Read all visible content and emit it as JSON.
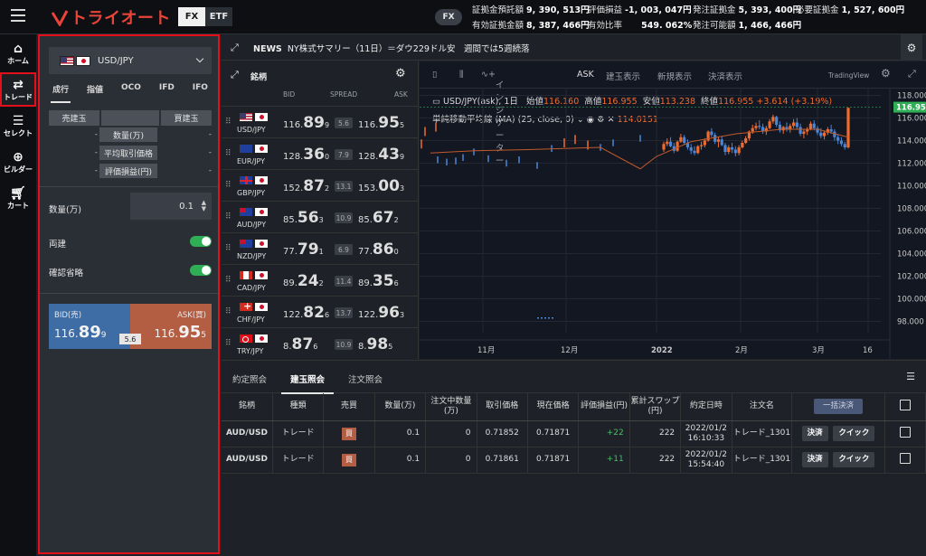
{
  "header": {
    "logo_text": "トライオート",
    "tabs": [
      "FX",
      "ETF"
    ],
    "active_tab": "FX",
    "account_pill": "FX",
    "stats": [
      {
        "label": "証拠金預託額",
        "value": "9, 390, 513円"
      },
      {
        "label": "評価損益",
        "value": "-1, 003, 047円"
      },
      {
        "label": "発注証拠金",
        "value": "5, 393, 400円"
      },
      {
        "label": "必要証拠金",
        "value": "1, 527, 600円"
      },
      {
        "label": "有効証拠金額",
        "value": "8, 387, 466円"
      },
      {
        "label": "有効比率",
        "value": "549. 062%"
      },
      {
        "label": "発注可能額",
        "value": "1, 466, 466円"
      }
    ]
  },
  "nav": [
    {
      "label": "ホーム",
      "icon": "home-icon"
    },
    {
      "label": "トレード",
      "icon": "trade-icon"
    },
    {
      "label": "セレクト",
      "icon": "select-icon"
    },
    {
      "label": "ビルダー",
      "icon": "builder-icon"
    },
    {
      "label": "カート",
      "icon": "cart-icon"
    }
  ],
  "order": {
    "pair": "USD/JPY",
    "tabs": [
      "成行",
      "指値",
      "OCO",
      "IFD",
      "IFO"
    ],
    "active_tab": "成行",
    "pos_headers": {
      "sell": "売建玉",
      "buy": "買建玉"
    },
    "pos_rows": [
      {
        "label": "数量(万)",
        "left": "-",
        "right": "-"
      },
      {
        "label": "平均取引価格",
        "left": "-",
        "right": "-"
      },
      {
        "label": "評価損益(円)",
        "left": "-",
        "right": "-"
      }
    ],
    "qty_label": "数量(万)",
    "qty_value": "0.1",
    "hedge_label": "両建",
    "confirm_label": "確認省略",
    "bid_label": "BID(売)",
    "ask_label": "ASK(買)",
    "bid_price": {
      "pre": "116.",
      "big": "89",
      "small": "9"
    },
    "ask_price": {
      "pre": "116.",
      "big": "95",
      "small": "5"
    },
    "spread": "5.6"
  },
  "news": {
    "label": "NEWS",
    "headline": "NY株式サマリー（11日）＝ダウ229ドル安　週間では5週続落"
  },
  "rates": {
    "title": "銘柄",
    "col_bid": "BID",
    "col_spread": "SPREAD",
    "col_ask": "ASK",
    "rows": [
      {
        "sym": "USD/JPY",
        "f": "us",
        "bid_pre": "116.",
        "bid_big": "89",
        "bid_small": "9",
        "spread": "5.6",
        "ask_pre": "116.",
        "ask_big": "95",
        "ask_small": "5"
      },
      {
        "sym": "EUR/JPY",
        "f": "eu",
        "bid_pre": "128.",
        "bid_big": "36",
        "bid_small": "0",
        "spread": "7.9",
        "ask_pre": "128.",
        "ask_big": "43",
        "ask_small": "9"
      },
      {
        "sym": "GBP/JPY",
        "f": "gb",
        "bid_pre": "152.",
        "bid_big": "87",
        "bid_small": "2",
        "spread": "13.1",
        "ask_pre": "153.",
        "ask_big": "00",
        "ask_small": "3"
      },
      {
        "sym": "AUD/JPY",
        "f": "au",
        "bid_pre": "85.",
        "bid_big": "56",
        "bid_small": "3",
        "spread": "10.9",
        "ask_pre": "85.",
        "ask_big": "67",
        "ask_small": "2"
      },
      {
        "sym": "NZD/JPY",
        "f": "nz",
        "bid_pre": "77.",
        "bid_big": "79",
        "bid_small": "1",
        "spread": "6.9",
        "ask_pre": "77.",
        "ask_big": "86",
        "ask_small": "0"
      },
      {
        "sym": "CAD/JPY",
        "f": "ca",
        "bid_pre": "89.",
        "bid_big": "24",
        "bid_small": "2",
        "spread": "11.4",
        "ask_pre": "89.",
        "ask_big": "35",
        "ask_small": "6"
      },
      {
        "sym": "CHF/JPY",
        "f": "ch",
        "bid_pre": "122.",
        "bid_big": "82",
        "bid_small": "6",
        "spread": "13.7",
        "ask_pre": "122.",
        "ask_big": "96",
        "ask_small": "3"
      },
      {
        "sym": "TRY/JPY",
        "f": "tr",
        "bid_pre": "8.",
        "bid_big": "87",
        "bid_small": "6",
        "spread": "10.9",
        "ask_pre": "8.",
        "ask_big": "98",
        "ask_small": "5"
      }
    ]
  },
  "chart_toolbar": {
    "indicator": "インジケーター",
    "ask": "ASK",
    "b1": "建玉表示",
    "b2": "新規表示",
    "b3": "決済表示",
    "brand": "TradingView"
  },
  "chart_info": {
    "symbol": "USD/JPY(ask), 1日",
    "open_label": "始値",
    "open": "116.160",
    "high_label": "高値",
    "high": "116.955",
    "low_label": "安値",
    "low": "113.238",
    "close_label": "終値",
    "close": "116.955",
    "change": "+3.614 (+3.19%)",
    "ma_label": "単純移動平均線 (MA) (25, close, 0)",
    "ma_value": "114.0151"
  },
  "chart_data": {
    "type": "candlestick",
    "x_ticks": [
      "11月",
      "12月",
      "2022",
      "2月",
      "3月",
      "16"
    ],
    "y_ticks": [
      98.0,
      100.0,
      102.0,
      104.0,
      106.0,
      108.0,
      110.0,
      112.0,
      114.0,
      116.0,
      118.0
    ],
    "ylim": [
      97.0,
      118.6
    ],
    "last_price": "116.955",
    "candles": [
      [
        113.2,
        113.9,
        113.0,
        113.7
      ],
      [
        113.7,
        114.2,
        113.5,
        113.9
      ],
      [
        113.9,
        114.3,
        113.4,
        113.5
      ],
      [
        113.5,
        113.8,
        112.9,
        113.1
      ],
      [
        113.1,
        114.0,
        113.0,
        113.9
      ],
      [
        113.9,
        114.6,
        113.8,
        114.3
      ],
      [
        114.3,
        114.5,
        113.6,
        113.8
      ],
      [
        113.8,
        114.1,
        113.2,
        113.4
      ],
      [
        113.4,
        113.7,
        112.8,
        113.1
      ],
      [
        113.1,
        113.5,
        112.7,
        112.9
      ],
      [
        112.9,
        113.6,
        112.8,
        113.5
      ],
      [
        113.5,
        113.9,
        113.2,
        113.6
      ],
      [
        113.6,
        114.2,
        113.4,
        114.0
      ],
      [
        114.0,
        114.9,
        113.9,
        114.8
      ],
      [
        114.8,
        115.1,
        114.3,
        114.5
      ],
      [
        114.5,
        114.7,
        113.7,
        113.9
      ],
      [
        113.9,
        114.3,
        113.4,
        114.1
      ],
      [
        114.1,
        114.4,
        113.5,
        113.6
      ],
      [
        113.6,
        113.8,
        112.7,
        113.0
      ],
      [
        113.0,
        113.6,
        112.8,
        113.4
      ],
      [
        113.4,
        113.8,
        112.9,
        113.2
      ],
      [
        113.2,
        113.5,
        112.6,
        112.9
      ],
      [
        112.9,
        113.6,
        112.7,
        113.4
      ],
      [
        113.4,
        114.0,
        113.3,
        113.8
      ],
      [
        113.8,
        114.4,
        113.7,
        114.2
      ],
      [
        114.2,
        114.9,
        114.0,
        114.8
      ],
      [
        114.8,
        115.4,
        114.6,
        115.1
      ],
      [
        115.1,
        115.6,
        114.9,
        115.3
      ],
      [
        115.3,
        115.8,
        115.0,
        115.2
      ],
      [
        115.2,
        115.5,
        114.6,
        114.8
      ],
      [
        114.8,
        115.3,
        114.5,
        115.1
      ],
      [
        115.1,
        115.9,
        115.0,
        115.7
      ],
      [
        115.7,
        116.3,
        115.5,
        116.1
      ],
      [
        116.1,
        116.2,
        115.2,
        115.4
      ],
      [
        115.4,
        115.7,
        114.7,
        114.9
      ],
      [
        114.9,
        115.3,
        114.6,
        115.2
      ],
      [
        115.2,
        115.6,
        114.8,
        115.0
      ],
      [
        115.0,
        115.5,
        114.7,
        115.3
      ],
      [
        115.3,
        115.9,
        115.1,
        115.6
      ],
      [
        115.6,
        116.0,
        115.0,
        115.2
      ],
      [
        115.2,
        115.5,
        114.4,
        114.6
      ],
      [
        114.6,
        115.0,
        114.2,
        114.8
      ],
      [
        114.8,
        115.2,
        114.5,
        115.0
      ],
      [
        115.0,
        115.7,
        114.9,
        115.5
      ],
      [
        115.5,
        115.8,
        114.9,
        115.1
      ],
      [
        115.1,
        115.3,
        114.5,
        114.7
      ],
      [
        114.7,
        115.1,
        114.2,
        114.4
      ],
      [
        114.4,
        114.9,
        114.1,
        114.7
      ],
      [
        114.7,
        115.2,
        114.5,
        115.0
      ],
      [
        115.0,
        115.4,
        114.6,
        114.8
      ],
      [
        114.8,
        115.0,
        114.0,
        114.3
      ],
      [
        114.3,
        114.6,
        113.7,
        114.0
      ],
      [
        114.0,
        114.3,
        113.5,
        113.7
      ],
      [
        113.7,
        113.9,
        113.2,
        113.4
      ],
      [
        113.4,
        116.9,
        113.3,
        116.9
      ]
    ],
    "ma": [
      [
        0,
        113.1
      ],
      [
        6,
        113.2
      ],
      [
        12,
        113.3
      ],
      [
        17,
        113.4
      ],
      [
        19,
        111.6
      ],
      [
        22,
        112.7
      ],
      [
        25,
        113.9
      ],
      [
        29,
        114.6
      ],
      [
        35,
        115.0
      ],
      [
        41,
        115.1
      ],
      [
        47,
        114.9
      ],
      [
        52,
        114.5
      ],
      [
        54,
        114.2
      ]
    ]
  },
  "bottom": {
    "tabs": [
      "約定照会",
      "建玉照会",
      "注文照会"
    ],
    "active_tab": "建玉照会",
    "headers": [
      "銘柄",
      "種類",
      "売買",
      "数量(万)",
      "注文中数量(万)",
      "取引価格",
      "現在価格",
      "評価損益(円)",
      "累計スワップ(円)",
      "約定日時",
      "注文名",
      "一括決済",
      ""
    ],
    "rows": [
      {
        "sym": "AUD/USD",
        "type": "トレード",
        "side": "買",
        "qty": "0.1",
        "pending": "0",
        "price": "0.71852",
        "current": "0.71871",
        "pl": "+22",
        "swap": "222",
        "date1": "2022/01/2",
        "date2": "16:10:33",
        "name": "トレード_1301",
        "settle": "決済",
        "quick": "クイック"
      },
      {
        "sym": "AUD/USD",
        "type": "トレード",
        "side": "買",
        "qty": "0.1",
        "pending": "0",
        "price": "0.71861",
        "current": "0.71871",
        "pl": "+11",
        "swap": "222",
        "date1": "2022/01/2",
        "date2": "15:54:40",
        "name": "トレード_1301",
        "settle": "決済",
        "quick": "クイック"
      }
    ]
  },
  "colors": {
    "accent_red": "#e3101c",
    "bid_blue": "#3e6da6",
    "ask_orange": "#b35d42",
    "candle_up": "#ef6c2f",
    "candle_down": "#4a86d8",
    "toggle_green": "#2fae56"
  }
}
